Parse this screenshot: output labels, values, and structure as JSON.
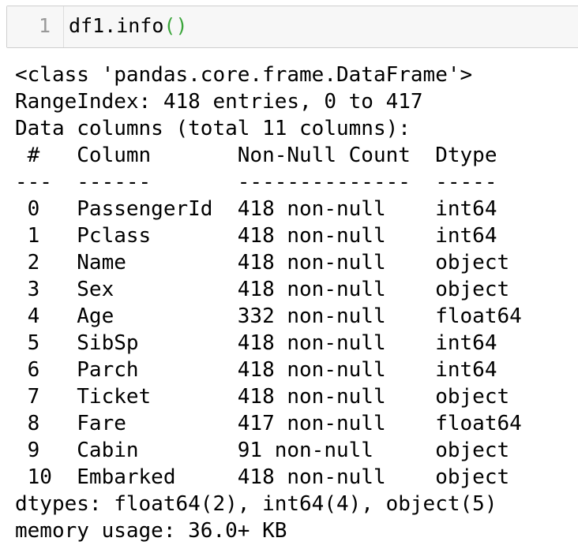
{
  "input_cell": {
    "line_number": "1",
    "code_object": "df1.info",
    "code_parens": "()"
  },
  "output_lines": [
    "<class 'pandas.core.frame.DataFrame'>",
    "RangeIndex: 418 entries, 0 to 417",
    "Data columns (total 11 columns):",
    " #   Column       Non-Null Count  Dtype  ",
    "---  ------       --------------  -----  ",
    " 0   PassengerId  418 non-null    int64  ",
    " 1   Pclass       418 non-null    int64  ",
    " 2   Name         418 non-null    object ",
    " 3   Sex          418 non-null    object ",
    " 4   Age          332 non-null    float64",
    " 5   SibSp        418 non-null    int64  ",
    " 6   Parch        418 non-null    int64  ",
    " 7   Ticket       418 non-null    object ",
    " 8   Fare         417 non-null    float64",
    " 9   Cabin        91 non-null     object ",
    " 10  Embarked     418 non-null    object ",
    "dtypes: float64(2), int64(4), object(5)",
    "memory usage: 36.0+ KB"
  ]
}
